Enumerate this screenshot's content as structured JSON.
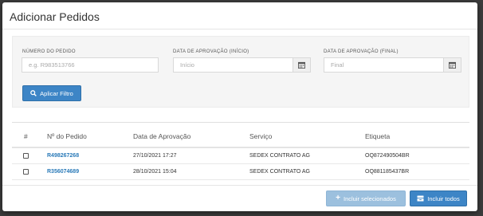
{
  "modal": {
    "title": "Adicionar Pedidos"
  },
  "filters": {
    "order_number": {
      "label": "NÚMERO DO PEDIDO",
      "placeholder": "e.g. R983513766"
    },
    "approval_start": {
      "label": "DATA DE APROVAÇÃO (INÍCIO)",
      "placeholder": "Início",
      "icon": "calendar-icon"
    },
    "approval_end": {
      "label": "DATA DE APROVAÇÃO (FINAL)",
      "placeholder": "Final",
      "icon": "calendar-icon"
    },
    "apply_button": {
      "label": "Aplicar Filtro",
      "icon": "search-icon"
    }
  },
  "table": {
    "columns": [
      "#",
      "Nº do Pedido",
      "Data de Aprovação",
      "Serviço",
      "Etiqueta"
    ],
    "rows": [
      {
        "checked": false,
        "order": "R498267268",
        "date": "27/10/2021 17:27",
        "service": "SEDEX CONTRATO AG",
        "tag": "OQ872490504BR"
      },
      {
        "checked": false,
        "order": "R356074689",
        "date": "28/10/2021 15:04",
        "service": "SEDEX CONTRATO AG",
        "tag": "OQ881185437BR"
      }
    ]
  },
  "footer": {
    "include_selected": {
      "label": "Incluir selecionados",
      "icon": "plus-icon"
    },
    "include_all": {
      "label": "Incluir todos",
      "icon": "stack-icon"
    }
  },
  "colors": {
    "primary": "#3d85c6",
    "disabled_primary": "#9cc0de",
    "link": "#2a7ab8"
  }
}
